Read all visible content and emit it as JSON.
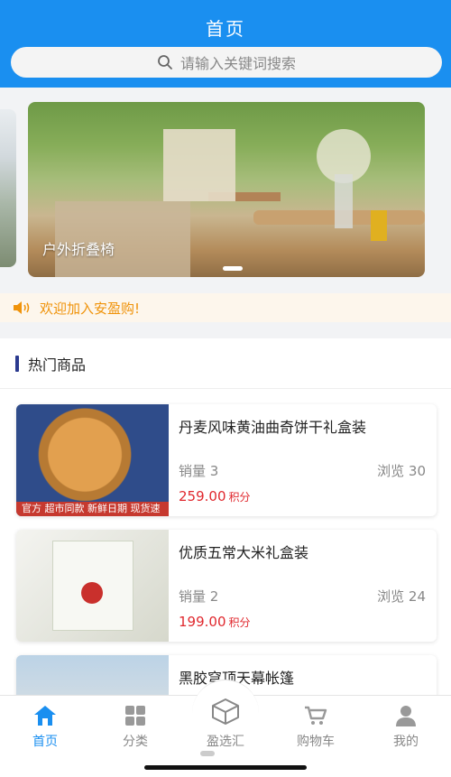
{
  "header": {
    "title": "首页"
  },
  "search": {
    "placeholder": "请输入关键词搜索",
    "icon": "search-icon"
  },
  "banner": {
    "caption": "户外折叠椅"
  },
  "notice": {
    "text": "欢迎加入安盈购!",
    "icon": "speaker-icon"
  },
  "hot": {
    "title": "热门商品",
    "products": [
      {
        "name": "丹麦风味黄油曲奇饼干礼盒装",
        "sales_label": "销量 3",
        "views_label": "浏览 30",
        "price": "259.00",
        "points_unit": "积分",
        "image_tag": "官方 超市同款 新鲜日期 现货速发"
      },
      {
        "name": "优质五常大米礼盒装",
        "sales_label": "销量 2",
        "views_label": "浏览 24",
        "price": "199.00",
        "points_unit": "积分"
      },
      {
        "name": "黑胶穹顶天幕帐篷"
      }
    ]
  },
  "tabbar": {
    "items": [
      {
        "label": "首页",
        "icon": "home-icon",
        "active": true
      },
      {
        "label": "分类",
        "icon": "grid-icon"
      },
      {
        "label": "盈选汇",
        "icon": "box-icon"
      },
      {
        "label": "购物车",
        "icon": "cart-icon"
      },
      {
        "label": "我的",
        "icon": "user-icon"
      }
    ]
  },
  "colors": {
    "primary": "#1a8ff0",
    "price": "#e0282e",
    "notice": "#f0930a"
  }
}
